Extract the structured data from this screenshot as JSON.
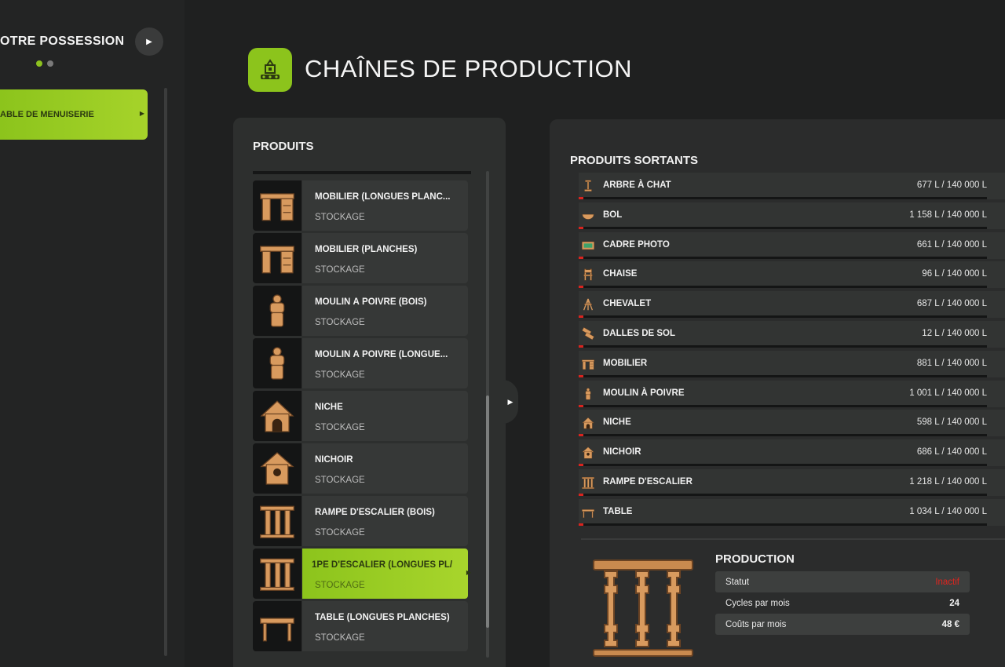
{
  "sidebar": {
    "title": "OTRE POSSESSION",
    "item": "ABLE DE MENUISERIE"
  },
  "header": {
    "title": "CHAÎNES DE PRODUCTION",
    "accent": "#8cc41c"
  },
  "produits": {
    "title": "PRODUITS",
    "items": [
      {
        "name": "MOBILIER (LONGUES PLANC...",
        "sub": "STOCKAGE",
        "icon": "desk-icon"
      },
      {
        "name": "MOBILIER (PLANCHES)",
        "sub": "STOCKAGE",
        "icon": "desk-icon"
      },
      {
        "name": "MOULIN À POIVRE (BOIS)",
        "sub": "STOCKAGE",
        "icon": "pepper-mill-icon"
      },
      {
        "name": "MOULIN À POIVRE (LONGUE...",
        "sub": "STOCKAGE",
        "icon": "pepper-mill-icon"
      },
      {
        "name": "NICHE",
        "sub": "STOCKAGE",
        "icon": "doghouse-icon"
      },
      {
        "name": "NICHOIR",
        "sub": "STOCKAGE",
        "icon": "birdhouse-icon"
      },
      {
        "name": "RAMPE D'ESCALIER (BOIS)",
        "sub": "STOCKAGE",
        "icon": "banister-icon"
      },
      {
        "name": "1PE D'ESCALIER (LONGUES PL/",
        "sub": "STOCKAGE",
        "icon": "banister-icon",
        "selected": true
      },
      {
        "name": "TABLE (LONGUES PLANCHES)",
        "sub": "STOCKAGE",
        "icon": "table-icon"
      }
    ]
  },
  "sortants": {
    "title": "PRODUITS SORTANTS",
    "capacity": 140000,
    "items": [
      {
        "name": "ARBRE À CHAT",
        "value": "677 L / 140 000 L",
        "amount": 677,
        "icon": "cat-tree-icon"
      },
      {
        "name": "BOL",
        "value": "1 158 L / 140 000 L",
        "amount": 1158,
        "icon": "bowl-icon"
      },
      {
        "name": "CADRE PHOTO",
        "value": "661 L / 140 000 L",
        "amount": 661,
        "icon": "photo-frame-icon"
      },
      {
        "name": "CHAISE",
        "value": "96 L / 140 000 L",
        "amount": 96,
        "icon": "chair-icon"
      },
      {
        "name": "CHEVALET",
        "value": "687 L / 140 000 L",
        "amount": 687,
        "icon": "easel-icon"
      },
      {
        "name": "DALLES DE SOL",
        "value": "12 L / 140 000 L",
        "amount": 12,
        "icon": "floor-tiles-icon"
      },
      {
        "name": "MOBILIER",
        "value": "881 L / 140 000 L",
        "amount": 881,
        "icon": "desk-icon"
      },
      {
        "name": "MOULIN À POIVRE",
        "value": "1 001 L / 140 000 L",
        "amount": 1001,
        "icon": "pepper-mill-icon"
      },
      {
        "name": "NICHE",
        "value": "598 L / 140 000 L",
        "amount": 598,
        "icon": "doghouse-icon"
      },
      {
        "name": "NICHOIR",
        "value": "686 L / 140 000 L",
        "amount": 686,
        "icon": "birdhouse-icon"
      },
      {
        "name": "RAMPE D'ESCALIER",
        "value": "1 218 L / 140 000 L",
        "amount": 1218,
        "icon": "banister-icon"
      },
      {
        "name": "TABLE",
        "value": "1 034 L / 140 000 L",
        "amount": 1034,
        "icon": "table-icon"
      }
    ]
  },
  "production": {
    "title": "PRODUCTION",
    "rows": [
      {
        "label": "Statut",
        "value": "Inactif",
        "status_color": "#e0241e"
      },
      {
        "label": "Cycles par mois",
        "value": "24"
      },
      {
        "label": "Coûts par mois",
        "value": "48 €"
      }
    ]
  }
}
